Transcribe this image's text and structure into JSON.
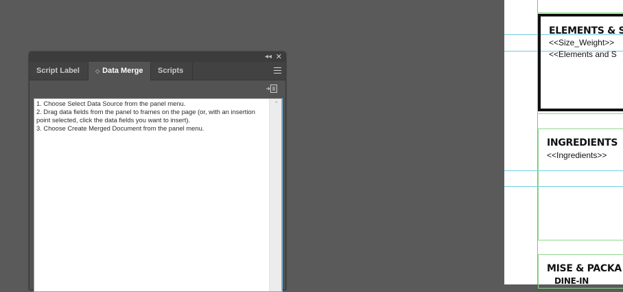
{
  "panel": {
    "collapse_glyph": "◂◂",
    "close_glyph": "✕",
    "tabs": [
      {
        "label": "Script Label",
        "active": false
      },
      {
        "label": "Data Merge",
        "active": true,
        "chevron": "◇"
      },
      {
        "label": "Scripts",
        "active": false
      }
    ],
    "instructions": [
      "1. Choose Select Data Source from the panel menu.",
      "2. Drag data fields from the panel to frames on the page (or, with an insertion point selected, click the data fields you want to insert).",
      "3. Choose Create Merged Document from the panel menu."
    ],
    "scroll_up_glyph": "⌃"
  },
  "document": {
    "frames": [
      {
        "heading": "ELEMENTS & S",
        "fields": [
          "<<Size_Weight>>",
          "<<Elements and S"
        ]
      },
      {
        "heading": "INGREDIENTS",
        "fields": [
          "<<Ingredients>>"
        ]
      },
      {
        "heading": "MISE & PACKA",
        "fields": [
          "DINE-IN"
        ]
      }
    ]
  },
  "colors": {
    "workspace": "#5a5a5a",
    "panel_bg": "#535353",
    "guide": "#6ccfe0",
    "margin": "#c58bd0",
    "frame_edge": "#8fd98f"
  }
}
